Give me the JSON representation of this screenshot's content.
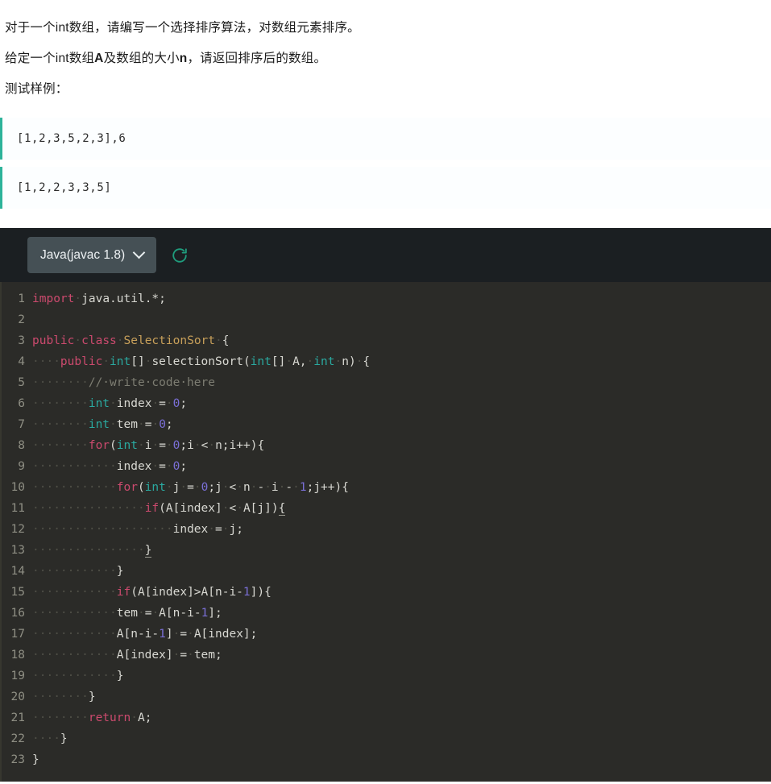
{
  "problem": {
    "lines": [
      {
        "parts": [
          {
            "t": "对于一个int数组，请编写一个选择排序算法，对数组元素排序。",
            "b": false
          }
        ]
      },
      {
        "parts": [
          {
            "t": "给定一个int数组",
            "b": false
          },
          {
            "t": "A",
            "b": true
          },
          {
            "t": "及数组的大小",
            "b": false
          },
          {
            "t": "n",
            "b": true
          },
          {
            "t": "，请返回排序后的数组。",
            "b": false
          }
        ]
      },
      {
        "parts": [
          {
            "t": "测试样例：",
            "b": false
          }
        ]
      }
    ]
  },
  "samples": {
    "accent_color": "#2eb39a",
    "blocks": [
      {
        "text": "[1,2,3,5,2,3],6"
      },
      {
        "text": "[1,2,2,3,3,5]"
      }
    ]
  },
  "editor": {
    "toolbar": {
      "language_label": "Java(javac 1.8)",
      "refresh_tooltip": "重置代码",
      "refresh_color": "#1f9c7d",
      "select_background": "#455055"
    },
    "background": "#2b2b28",
    "toolbar_background": "#1b1f22",
    "colors": {
      "keyword": "#cc4a6e",
      "type": "#2aa9a0",
      "class_name": "#c8a05a",
      "number": "#7a6fd6",
      "comment": "#7d7d72",
      "plain": "#d8d8d2",
      "line_number": "#8f8f84"
    },
    "lines": [
      {
        "n": "1",
        "tokens": [
          {
            "c": "kw",
            "t": "import"
          },
          {
            "c": "dot",
            "t": "·"
          },
          {
            "c": "pln",
            "t": "java.util.*;"
          }
        ]
      },
      {
        "n": "2",
        "tokens": []
      },
      {
        "n": "3",
        "tokens": [
          {
            "c": "kw",
            "t": "public"
          },
          {
            "c": "dot",
            "t": "·"
          },
          {
            "c": "kw",
            "t": "class"
          },
          {
            "c": "dot",
            "t": "·"
          },
          {
            "c": "cls",
            "t": "SelectionSort"
          },
          {
            "c": "dot",
            "t": "·"
          },
          {
            "c": "pln",
            "t": "{"
          }
        ]
      },
      {
        "n": "4",
        "tokens": [
          {
            "c": "dot",
            "t": "····"
          },
          {
            "c": "kw",
            "t": "public"
          },
          {
            "c": "dot",
            "t": "·"
          },
          {
            "c": "type",
            "t": "int"
          },
          {
            "c": "pln",
            "t": "[]"
          },
          {
            "c": "dot",
            "t": "·"
          },
          {
            "c": "pln",
            "t": "selectionSort("
          },
          {
            "c": "type",
            "t": "int"
          },
          {
            "c": "pln",
            "t": "[]"
          },
          {
            "c": "dot",
            "t": "·"
          },
          {
            "c": "pln",
            "t": "A,"
          },
          {
            "c": "dot",
            "t": "·"
          },
          {
            "c": "type",
            "t": "int"
          },
          {
            "c": "dot",
            "t": "·"
          },
          {
            "c": "pln",
            "t": "n)"
          },
          {
            "c": "dot",
            "t": "·"
          },
          {
            "c": "pln",
            "t": "{"
          }
        ]
      },
      {
        "n": "5",
        "tokens": [
          {
            "c": "dot",
            "t": "········"
          },
          {
            "c": "cmt",
            "t": "//·write·code·here"
          }
        ]
      },
      {
        "n": "6",
        "tokens": [
          {
            "c": "dot",
            "t": "········"
          },
          {
            "c": "type",
            "t": "int"
          },
          {
            "c": "dot",
            "t": "·"
          },
          {
            "c": "pln",
            "t": "index"
          },
          {
            "c": "dot",
            "t": "·"
          },
          {
            "c": "pln",
            "t": "="
          },
          {
            "c": "dot",
            "t": "·"
          },
          {
            "c": "num",
            "t": "0"
          },
          {
            "c": "pln",
            "t": ";"
          }
        ]
      },
      {
        "n": "7",
        "tokens": [
          {
            "c": "dot",
            "t": "········"
          },
          {
            "c": "type",
            "t": "int"
          },
          {
            "c": "dot",
            "t": "·"
          },
          {
            "c": "pln",
            "t": "tem"
          },
          {
            "c": "dot",
            "t": "·"
          },
          {
            "c": "pln",
            "t": "="
          },
          {
            "c": "dot",
            "t": "·"
          },
          {
            "c": "num",
            "t": "0"
          },
          {
            "c": "pln",
            "t": ";"
          }
        ]
      },
      {
        "n": "8",
        "tokens": [
          {
            "c": "dot",
            "t": "········"
          },
          {
            "c": "kw",
            "t": "for"
          },
          {
            "c": "pln",
            "t": "("
          },
          {
            "c": "type",
            "t": "int"
          },
          {
            "c": "dot",
            "t": "·"
          },
          {
            "c": "pln",
            "t": "i"
          },
          {
            "c": "dot",
            "t": "·"
          },
          {
            "c": "pln",
            "t": "="
          },
          {
            "c": "dot",
            "t": "·"
          },
          {
            "c": "num",
            "t": "0"
          },
          {
            "c": "pln",
            "t": ";i"
          },
          {
            "c": "dot",
            "t": "·"
          },
          {
            "c": "pln",
            "t": "<"
          },
          {
            "c": "dot",
            "t": "·"
          },
          {
            "c": "pln",
            "t": "n;i++){"
          }
        ]
      },
      {
        "n": "9",
        "tokens": [
          {
            "c": "dot",
            "t": "············"
          },
          {
            "c": "pln",
            "t": "index"
          },
          {
            "c": "dot",
            "t": "·"
          },
          {
            "c": "pln",
            "t": "="
          },
          {
            "c": "dot",
            "t": "·"
          },
          {
            "c": "num",
            "t": "0"
          },
          {
            "c": "pln",
            "t": ";"
          }
        ]
      },
      {
        "n": "10",
        "tokens": [
          {
            "c": "dot",
            "t": "············"
          },
          {
            "c": "kw",
            "t": "for"
          },
          {
            "c": "pln",
            "t": "("
          },
          {
            "c": "type",
            "t": "int"
          },
          {
            "c": "dot",
            "t": "·"
          },
          {
            "c": "pln",
            "t": "j"
          },
          {
            "c": "dot",
            "t": "·"
          },
          {
            "c": "pln",
            "t": "="
          },
          {
            "c": "dot",
            "t": "·"
          },
          {
            "c": "num",
            "t": "0"
          },
          {
            "c": "pln",
            "t": ";j"
          },
          {
            "c": "dot",
            "t": "·"
          },
          {
            "c": "pln",
            "t": "<"
          },
          {
            "c": "dot",
            "t": "·"
          },
          {
            "c": "pln",
            "t": "n"
          },
          {
            "c": "dot",
            "t": "·"
          },
          {
            "c": "pln",
            "t": "-"
          },
          {
            "c": "dot",
            "t": "·"
          },
          {
            "c": "pln",
            "t": "i"
          },
          {
            "c": "dot",
            "t": "·"
          },
          {
            "c": "pln",
            "t": "-"
          },
          {
            "c": "dot",
            "t": "·"
          },
          {
            "c": "num",
            "t": "1"
          },
          {
            "c": "pln",
            "t": ";j++){"
          }
        ]
      },
      {
        "n": "11",
        "tokens": [
          {
            "c": "dot",
            "t": "················"
          },
          {
            "c": "kw",
            "t": "if"
          },
          {
            "c": "pln",
            "t": "(A[index]"
          },
          {
            "c": "dot",
            "t": "·"
          },
          {
            "c": "pln",
            "t": "<"
          },
          {
            "c": "dot",
            "t": "·"
          },
          {
            "c": "pln",
            "t": "A[j])"
          },
          {
            "c": "match",
            "t": "{"
          }
        ]
      },
      {
        "n": "12",
        "tokens": [
          {
            "c": "dot",
            "t": "····················"
          },
          {
            "c": "pln",
            "t": "index"
          },
          {
            "c": "dot",
            "t": "·"
          },
          {
            "c": "pln",
            "t": "="
          },
          {
            "c": "dot",
            "t": "·"
          },
          {
            "c": "pln",
            "t": "j;"
          }
        ]
      },
      {
        "n": "13",
        "tokens": [
          {
            "c": "dot",
            "t": "················"
          },
          {
            "c": "match",
            "t": "}"
          }
        ]
      },
      {
        "n": "14",
        "tokens": [
          {
            "c": "dot",
            "t": "············"
          },
          {
            "c": "pln",
            "t": "}"
          }
        ]
      },
      {
        "n": "15",
        "tokens": [
          {
            "c": "dot",
            "t": "············"
          },
          {
            "c": "kw",
            "t": "if"
          },
          {
            "c": "pln",
            "t": "(A[index]>A[n-i-"
          },
          {
            "c": "num",
            "t": "1"
          },
          {
            "c": "pln",
            "t": "]){"
          }
        ]
      },
      {
        "n": "16",
        "tokens": [
          {
            "c": "dot",
            "t": "············"
          },
          {
            "c": "pln",
            "t": "tem"
          },
          {
            "c": "dot",
            "t": "·"
          },
          {
            "c": "pln",
            "t": "="
          },
          {
            "c": "dot",
            "t": "·"
          },
          {
            "c": "pln",
            "t": "A[n-i-"
          },
          {
            "c": "num",
            "t": "1"
          },
          {
            "c": "pln",
            "t": "];"
          }
        ]
      },
      {
        "n": "17",
        "tokens": [
          {
            "c": "dot",
            "t": "············"
          },
          {
            "c": "pln",
            "t": "A[n-i-"
          },
          {
            "c": "num",
            "t": "1"
          },
          {
            "c": "pln",
            "t": "]"
          },
          {
            "c": "dot",
            "t": "·"
          },
          {
            "c": "pln",
            "t": "="
          },
          {
            "c": "dot",
            "t": "·"
          },
          {
            "c": "pln",
            "t": "A[index];"
          }
        ]
      },
      {
        "n": "18",
        "tokens": [
          {
            "c": "dot",
            "t": "············"
          },
          {
            "c": "pln",
            "t": "A[index]"
          },
          {
            "c": "dot",
            "t": "·"
          },
          {
            "c": "pln",
            "t": "="
          },
          {
            "c": "dot",
            "t": "·"
          },
          {
            "c": "pln",
            "t": "tem;"
          }
        ]
      },
      {
        "n": "19",
        "tokens": [
          {
            "c": "dot",
            "t": "············"
          },
          {
            "c": "pln",
            "t": "}"
          }
        ]
      },
      {
        "n": "20",
        "tokens": [
          {
            "c": "dot",
            "t": "········"
          },
          {
            "c": "pln",
            "t": "}"
          }
        ]
      },
      {
        "n": "21",
        "tokens": [
          {
            "c": "dot",
            "t": "········"
          },
          {
            "c": "kw",
            "t": "return"
          },
          {
            "c": "dot",
            "t": "·"
          },
          {
            "c": "pln",
            "t": "A;"
          }
        ]
      },
      {
        "n": "22",
        "tokens": [
          {
            "c": "dot",
            "t": "····"
          },
          {
            "c": "pln",
            "t": "}"
          }
        ]
      },
      {
        "n": "23",
        "tokens": [
          {
            "c": "pln",
            "t": "}"
          }
        ]
      }
    ]
  }
}
